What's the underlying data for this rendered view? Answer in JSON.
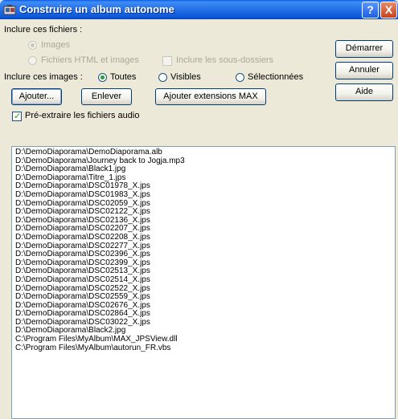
{
  "window": {
    "title": "Construire un album autonome"
  },
  "titlebar": {
    "help_label": "?",
    "close_label": "X"
  },
  "files_group": {
    "label": "Inclure ces fichiers :",
    "option_images": "Images",
    "option_html": "Fichiers HTML et images",
    "option_subfolders": "Inclure les sous-dossiers"
  },
  "images_group": {
    "label": "Inclure ces images :",
    "option_all": "Toutes",
    "option_visible": "Visibles",
    "option_selected": "Sélectionnées"
  },
  "buttons": {
    "start": "Démarrer",
    "cancel": "Annuler",
    "help": "Aide",
    "add": "Ajouter...",
    "remove": "Enlever",
    "add_max": "Ajouter extensions MAX"
  },
  "preextract": {
    "label": "Pré-extraire les fichiers audio"
  },
  "file_list": [
    "D:\\DemoDiaporama\\DemoDiaporama.alb",
    "D:\\DemoDiaporama\\Journey back to Jogja.mp3",
    "D:\\DemoDiaporama\\Black1.jpg",
    "D:\\DemoDiaporama\\Titre_1.jps",
    "D:\\DemoDiaporama\\DSC01978_X.jps",
    "D:\\DemoDiaporama\\DSC01983_X.jps",
    "D:\\DemoDiaporama\\DSC02059_X.jps",
    "D:\\DemoDiaporama\\DSC02122_X.jps",
    "D:\\DemoDiaporama\\DSC02136_X.jps",
    "D:\\DemoDiaporama\\DSC02207_X.jps",
    "D:\\DemoDiaporama\\DSC02208_X.jps",
    "D:\\DemoDiaporama\\DSC02277_X.jps",
    "D:\\DemoDiaporama\\DSC02396_X.jps",
    "D:\\DemoDiaporama\\DSC02399_X.jps",
    "D:\\DemoDiaporama\\DSC02513_X.jps",
    "D:\\DemoDiaporama\\DSC02514_X.jps",
    "D:\\DemoDiaporama\\DSC02522_X.jps",
    "D:\\DemoDiaporama\\DSC02559_X.jps",
    "D:\\DemoDiaporama\\DSC02676_X.jps",
    "D:\\DemoDiaporama\\DSC02864_X.jps",
    "D:\\DemoDiaporama\\DSC03022_X.jps",
    "D:\\DemoDiaporama\\Black2.jpg",
    "C:\\Program Files\\MyAlbum\\MAX_JPSView.dll",
    "C:\\Program Files\\MyAlbum\\autorun_FR.vbs"
  ]
}
